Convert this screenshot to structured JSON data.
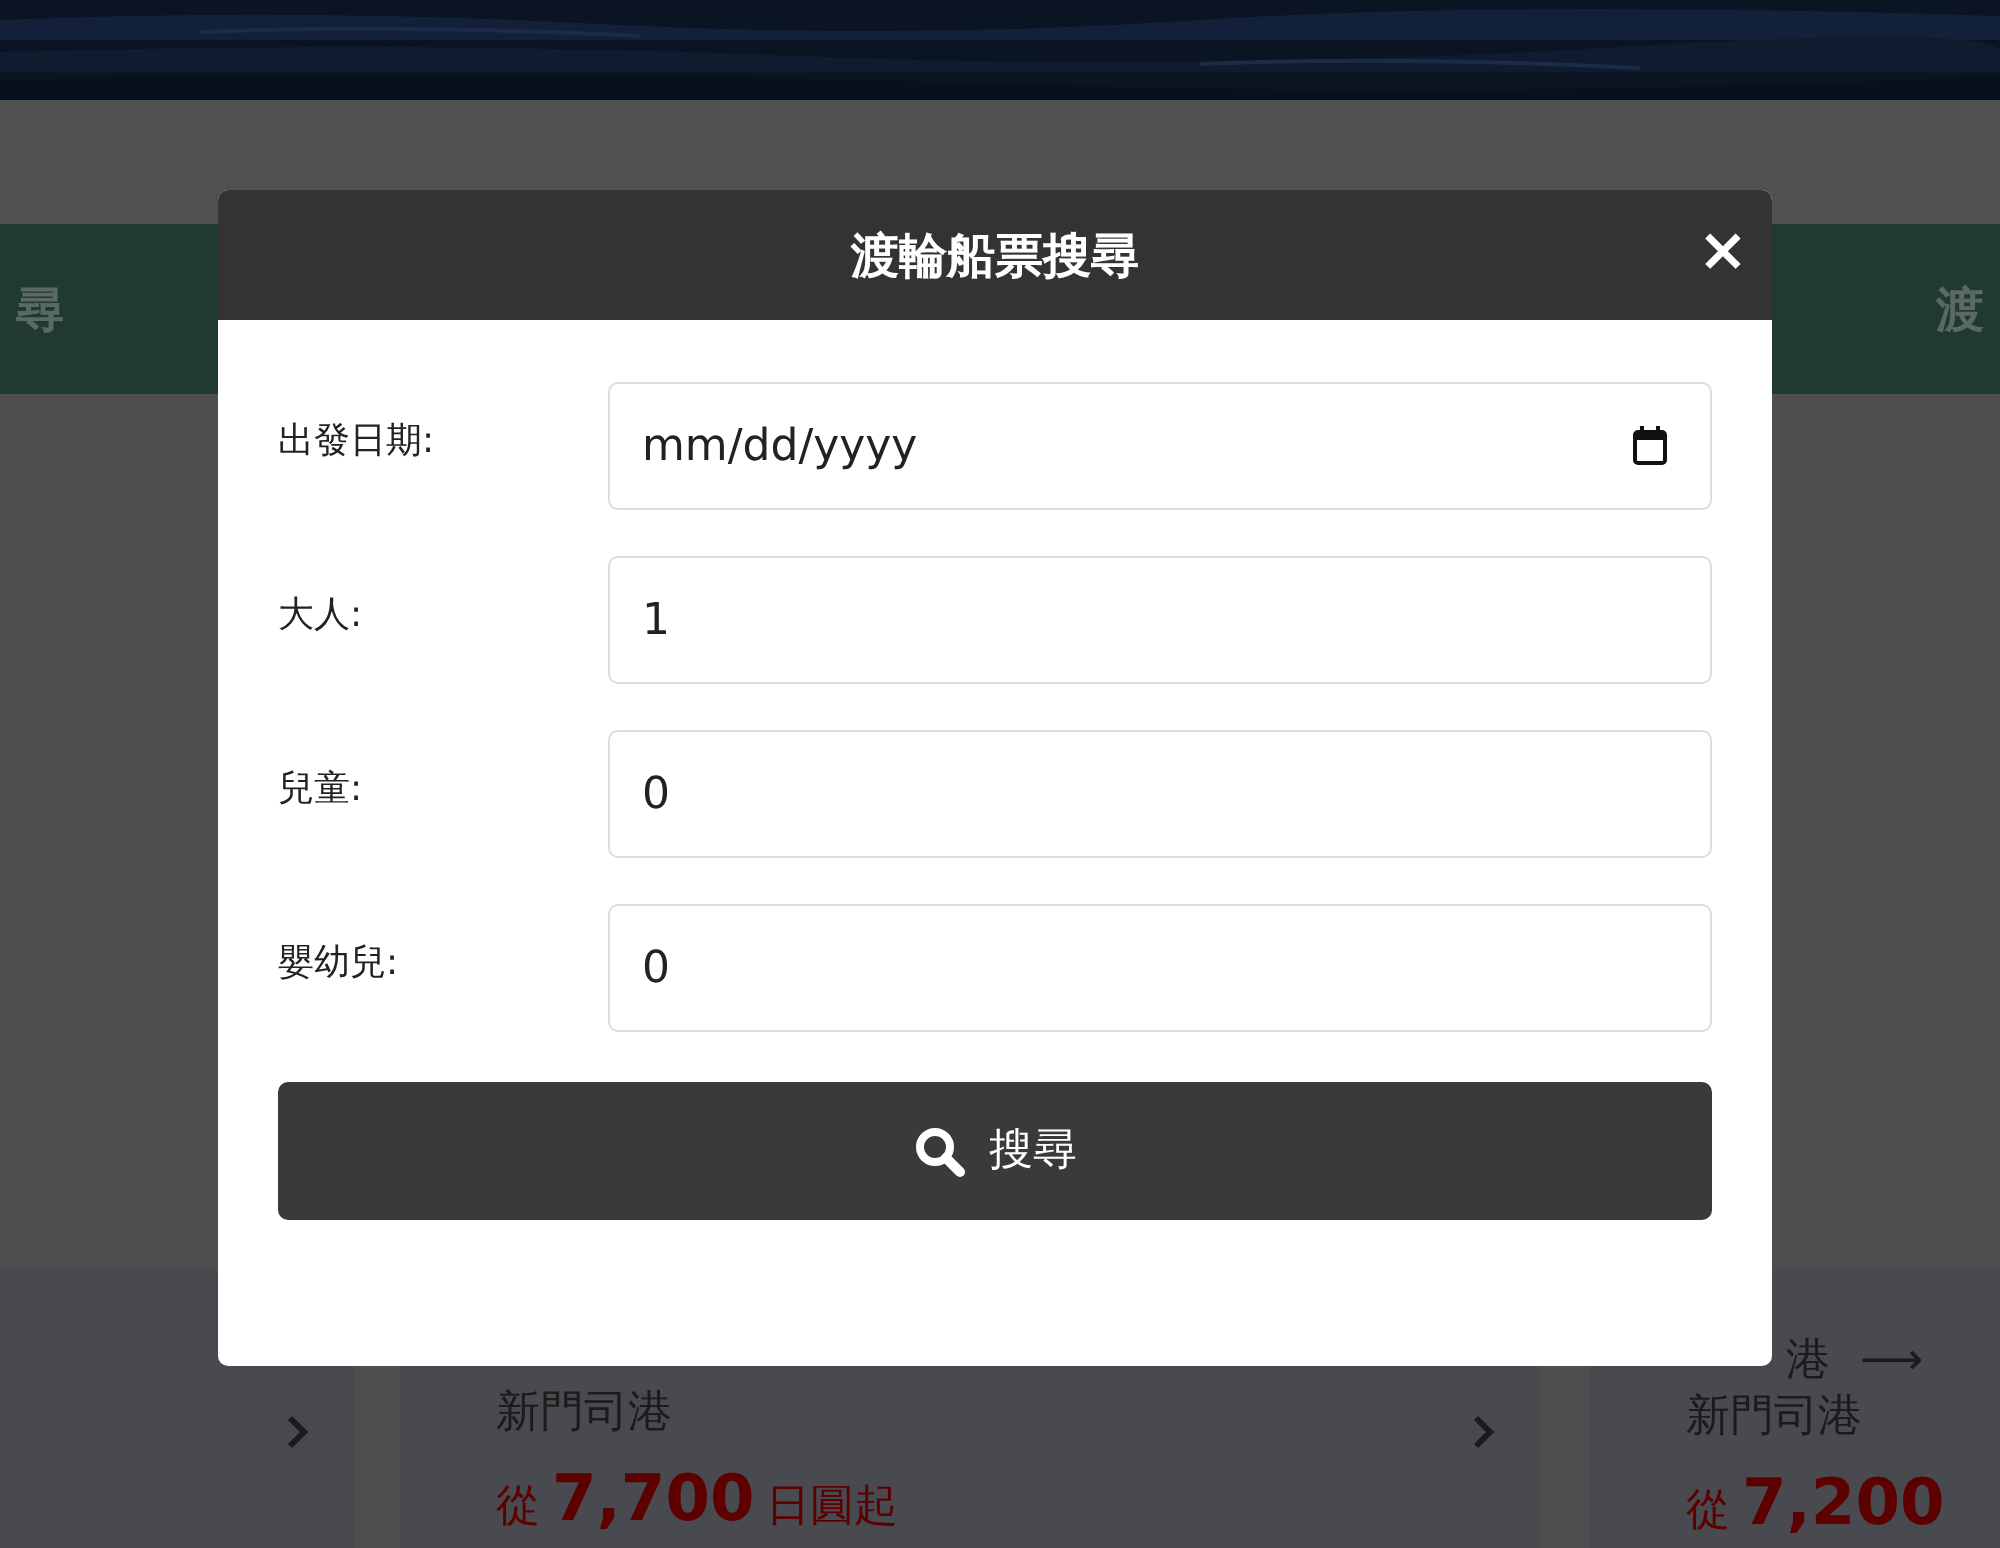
{
  "background": {
    "tabs": [
      {
        "label": "尋"
      },
      {
        "label": "渡"
      }
    ],
    "cards": [
      {
        "chevron": true
      },
      {
        "lines": [
          "新門司港"
        ],
        "price_prefix": "從",
        "price": "7,700",
        "price_suffix": "日圓起",
        "chevron": true
      },
      {
        "lines": [
          "港",
          "新門司港"
        ],
        "arrow": "⟶",
        "price_prefix": "從",
        "price": "7,200",
        "chevron": false
      }
    ]
  },
  "modal": {
    "title": "渡輪船票搜尋",
    "close": "×",
    "fields": [
      {
        "label": "出發日期:",
        "kind": "date",
        "placeholder": "mm/dd/yyyy"
      },
      {
        "label": "大人:",
        "kind": "number",
        "value": "1"
      },
      {
        "label": "兒童:",
        "kind": "number",
        "value": "0"
      },
      {
        "label": "嬰幼兒:",
        "kind": "number",
        "value": "0"
      }
    ],
    "button": {
      "label": "搜尋"
    }
  }
}
